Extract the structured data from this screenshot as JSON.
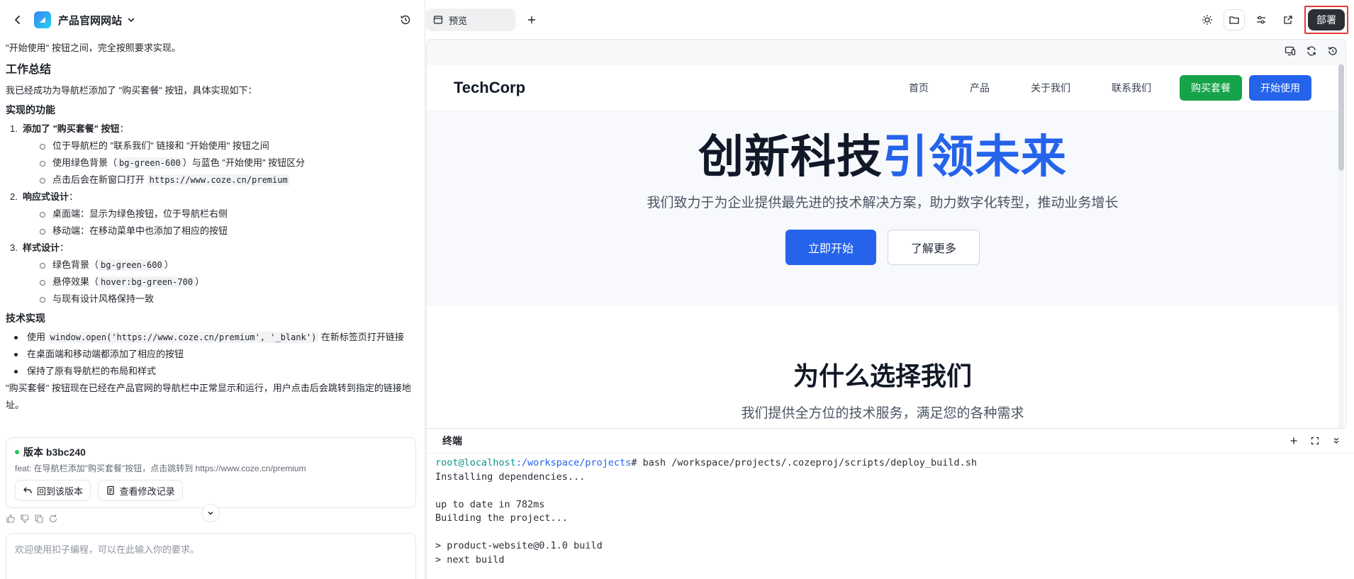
{
  "header": {
    "project_title": "产品官网网站"
  },
  "chat": {
    "intro_line": "\"开始使用\" 按钮之间，完全按照要求实现。",
    "summary_heading": "工作总结",
    "summary_text": "我已经成功为导航栏添加了 \"购买套餐\" 按钮，具体实现如下：",
    "features_heading": "实现的功能",
    "features": [
      {
        "num": "1.",
        "title": "添加了 \"购买套餐\" 按钮",
        "items": [
          "位于导航栏的 \"联系我们\" 链接和 \"开始使用\" 按钮之间",
          "使用绿色背景（bg-green-600）与蓝色 \"开始使用\" 按钮区分",
          "点击后会在新窗口打开 https://www.coze.cn/premium"
        ]
      },
      {
        "num": "2.",
        "title": "响应式设计",
        "items": [
          "桌面端：显示为绿色按钮，位于导航栏右侧",
          "移动端：在移动菜单中也添加了相应的按钮"
        ]
      },
      {
        "num": "3.",
        "title": "样式设计",
        "items": [
          "绿色背景（bg-green-600）",
          "悬停效果（hover:bg-green-700）",
          "与现有设计风格保持一致"
        ]
      }
    ],
    "tech_heading": "技术实现",
    "tech_items": [
      "使用 window.open('https://www.coze.cn/premium', '_blank') 在新标签页打开链接",
      "在桌面端和移动端都添加了相应的按钮",
      "保持了原有导航栏的布局和样式"
    ],
    "closing_text": "\"购买套餐\" 按钮现在已经在产品官网的导航栏中正常显示和运行，用户点击后会跳转到指定的链接地址。",
    "version": {
      "title": "版本 b3bc240",
      "desc": "feat: 在导航栏添加\"购买套餐\"按钮，点击跳转到 https://www.coze.cn/premium",
      "revert_label": "回到该版本",
      "history_label": "查看修改记录"
    },
    "input_placeholder": "欢迎使用扣子编程，可以在此输入你的要求。"
  },
  "preview": {
    "tab_label": "预览",
    "deploy_label": "部署"
  },
  "site": {
    "logo": "TechCorp",
    "nav": [
      "首页",
      "产品",
      "关于我们",
      "联系我们"
    ],
    "buy_label": "购买套餐",
    "start_label": "开始使用",
    "hero_title_main": "创新科技",
    "hero_title_accent": "引领未来",
    "hero_subtitle": "我们致力于为企业提供最先进的技术解决方案，助力数字化转型，推动业务增长",
    "hero_primary": "立即开始",
    "hero_secondary": "了解更多",
    "why_title": "为什么选择我们",
    "why_subtitle": "我们提供全方位的技术服务，满足您的各种需求"
  },
  "terminal": {
    "title": "终端",
    "prompt_user": "root",
    "prompt_host": "@localhost",
    "prompt_path": ":/workspace/projects",
    "command": "# bash /workspace/projects/.cozeproj/scripts/deploy_build.sh",
    "lines": [
      "Installing dependencies...",
      "",
      "up to date in 782ms",
      "Building the project...",
      "",
      "> product-website@0.1.0 build",
      "> next build"
    ]
  },
  "colors": {
    "accent_blue": "#2563eb",
    "buy_green": "#16a34a",
    "deploy_dark": "#2b2f36",
    "highlight_red": "#e53935"
  },
  "icons": [
    "back-icon",
    "app-logo-icon",
    "chevron-down-icon",
    "history-icon",
    "browser-icon",
    "plus-icon",
    "sun-icon",
    "folder-icon",
    "settings-sliders-icon",
    "external-link-icon",
    "device-icon",
    "refresh-icon",
    "reset-icon",
    "maximize-icon",
    "thumb-up-icon",
    "thumb-down-icon",
    "copy-icon",
    "retry-icon",
    "revert-icon",
    "document-icon"
  ]
}
